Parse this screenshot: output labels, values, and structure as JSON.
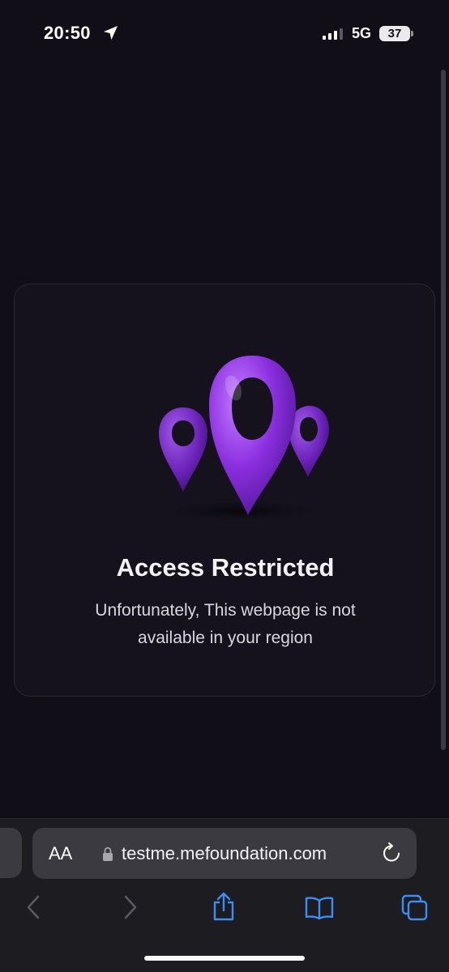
{
  "status_bar": {
    "time": "20:50",
    "network": "5G",
    "battery": "37",
    "icons": [
      "location-arrow-icon",
      "cellular-signal-icon",
      "battery-icon"
    ]
  },
  "card": {
    "title": "Access Restricted",
    "message": "Unfortunately, This webpage is not available in your region",
    "illustration": "location-pins-icon",
    "accent_color": "#8b2fe0"
  },
  "browser": {
    "text_size_button": "AA",
    "url": "testme.mefoundation.com",
    "icons": [
      "lock-icon",
      "reload-icon",
      "back-icon",
      "forward-icon",
      "share-icon",
      "bookmarks-icon",
      "tabs-icon"
    ],
    "active_icon_color": "#3a8ef6",
    "disabled_icon_color": "#5a5a62"
  }
}
